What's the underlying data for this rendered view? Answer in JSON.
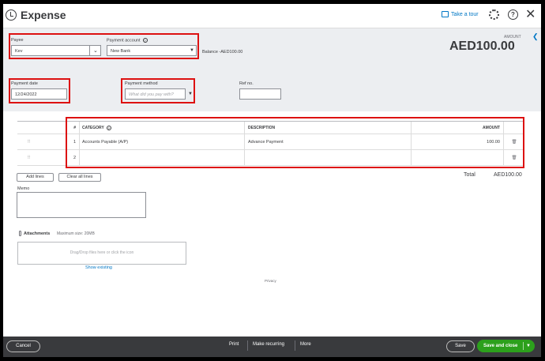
{
  "header": {
    "title": "Expense",
    "take_tour": "Take a tour",
    "help_label": "?"
  },
  "payee": {
    "label": "Payee",
    "value": "Kev"
  },
  "payment_account": {
    "label": "Payment account",
    "value": "New Bank",
    "balance": "Balance -AED100.00"
  },
  "amount": {
    "label": "AMOUNT",
    "value": "AED100.00"
  },
  "payment_date": {
    "label": "Payment date",
    "value": "12/24/2022"
  },
  "payment_method": {
    "label": "Payment method",
    "placeholder": "What did you pay with?"
  },
  "ref_no": {
    "label": "Ref no.",
    "value": ""
  },
  "table": {
    "headers": {
      "num": "#",
      "category": "CATEGORY",
      "description": "DESCRIPTION",
      "amount": "AMOUNT"
    },
    "rows": [
      {
        "num": "1",
        "category": "Accounts Payable (A/P)",
        "description": "Advance Payment",
        "amount": "100.00"
      },
      {
        "num": "2",
        "category": "",
        "description": "",
        "amount": ""
      }
    ]
  },
  "buttons": {
    "add_lines": "Add lines",
    "clear_all_lines": "Clear all lines"
  },
  "total": {
    "label": "Total",
    "value": "AED100.00"
  },
  "memo": {
    "label": "Memo"
  },
  "attachments": {
    "label": "Attachments",
    "max_size": "Maximum size: 20MB",
    "drop_text": "Drag/Drop files here or click the icon",
    "show_existing": "Show existing"
  },
  "privacy": "Privacy",
  "footer": {
    "cancel": "Cancel",
    "print": "Print",
    "make_recurring": "Make recurring",
    "more": "More",
    "save": "Save",
    "save_and_close": "Save and close"
  },
  "colors": {
    "accent": "#0077c5",
    "green": "#2ca01c",
    "footer_bg": "#393a3d",
    "highlight": "#dd1111"
  }
}
